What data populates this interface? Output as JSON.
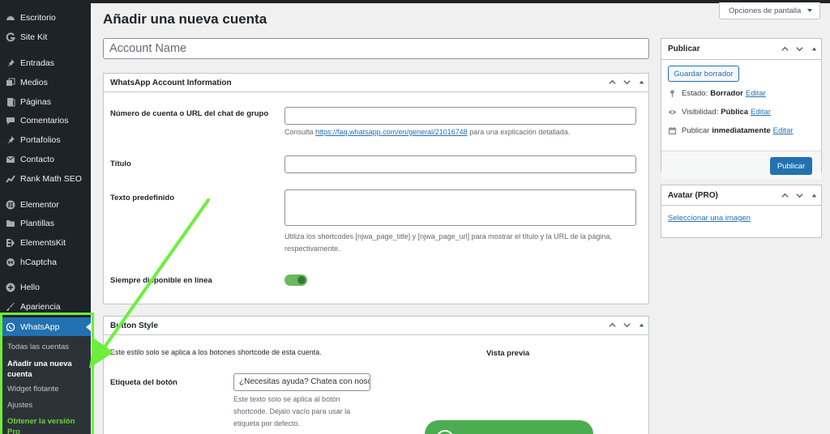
{
  "sidebar": {
    "items": [
      {
        "label": "Escritorio",
        "icon": "dashboard-icon"
      },
      {
        "label": "Site Kit",
        "icon": "sitekit-icon"
      },
      {
        "label": "Entradas",
        "icon": "pin-icon"
      },
      {
        "label": "Medios",
        "icon": "media-icon"
      },
      {
        "label": "Páginas",
        "icon": "pages-icon"
      },
      {
        "label": "Comentarios",
        "icon": "comment-icon"
      },
      {
        "label": "Portafolios",
        "icon": "pin-icon"
      },
      {
        "label": "Contacto",
        "icon": "mail-icon"
      },
      {
        "label": "Rank Math SEO",
        "icon": "chart-icon"
      },
      {
        "label": "Elementor",
        "icon": "elementor-icon"
      },
      {
        "label": "Plantillas",
        "icon": "folder-icon"
      },
      {
        "label": "ElementsKit",
        "icon": "elementskit-icon"
      },
      {
        "label": "hCaptcha",
        "icon": "hcaptcha-icon"
      },
      {
        "label": "Hello",
        "icon": "plus-circle-icon"
      },
      {
        "label": "Apariencia",
        "icon": "brush-icon"
      }
    ],
    "whatsapp": {
      "label": "WhatsApp",
      "icon": "whatsapp-icon"
    },
    "submenu": [
      "Todas las cuentas",
      "Añadir una nueva cuenta",
      "Widget flotante",
      "Ajustes",
      "Obtener la versión Pro"
    ]
  },
  "header": {
    "title": "Añadir una nueva cuenta",
    "screen_options": "Opciones de pantalla"
  },
  "account_name_placeholder": "Account Name",
  "info_box": {
    "title": "WhatsApp Account Information",
    "number_label": "Número de cuenta o URL del chat de grupo",
    "number_desc_prefix": "Consulta",
    "number_link": "https://faq.whatsapp.com/en/general/21016748",
    "number_desc_suffix": "para una explicación detallada.",
    "title_label": "Título",
    "predefined_label": "Texto predefinido",
    "predefined_desc": "Utiliza los shortcodes [njwa_page_title] y [njwa_page_url] para mostrar el título y la URL de la página, respectivamente.",
    "online_label": "Siempre disponible en línea",
    "online_enabled": true
  },
  "style_box": {
    "title": "Button Style",
    "intro": "Este estilo solo se aplica a los botones shortcode de esta cuenta.",
    "preview_label": "Vista previa",
    "button_label": "Etiqueta del botón",
    "button_value": "¿Necesitas ayuda? Chatea con nosotros",
    "button_desc": "Este texto solo se aplica al botón shortcode. Déjalo vacío para usar la etiqueta por defecto."
  },
  "publish_box": {
    "title": "Publicar",
    "save_draft": "Guardar borrador",
    "status_label": "Estado:",
    "status_value": "Borrador",
    "visibility_label": "Visibilidad:",
    "visibility_value": "Pública",
    "publish_label": "Publicar",
    "publish_when": "inmediatamente",
    "edit": "Editar",
    "publish_button": "Publicar"
  },
  "avatar_box": {
    "title": "Avatar (PRO)",
    "link": "Seleccionar una imagen"
  },
  "colors": {
    "admin_bg": "#1d2327",
    "accent": "#2271b1",
    "highlight": "#6cf03b",
    "whatsapp_green": "#4cad50"
  }
}
